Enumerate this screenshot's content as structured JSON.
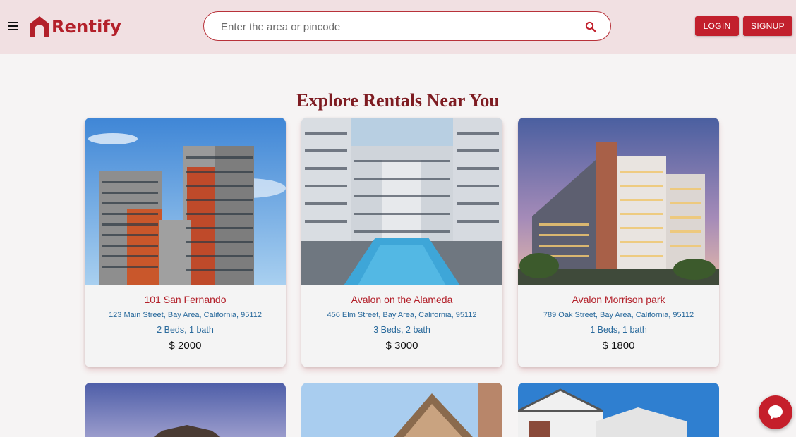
{
  "header": {
    "brand": "Rentify",
    "search_placeholder": "Enter the area or pincode",
    "login_label": "LOGIN",
    "signup_label": "SIGNUP",
    "icons": {
      "menu": "menu-icon",
      "search": "search-icon",
      "logo": "house-logo-icon"
    }
  },
  "main": {
    "heading": "Explore Rentals Near You",
    "listings": [
      {
        "name": "101 San Fernando",
        "address": "123 Main Street, Bay Area, California, 95112",
        "rooms": "2 Beds, 1 bath",
        "price": "$ 2000"
      },
      {
        "name": "Avalon on the Alameda",
        "address": "456 Elm Street, Bay Area, California, 95112",
        "rooms": "3 Beds, 2 bath",
        "price": "$ 3000"
      },
      {
        "name": "Avalon Morrison park",
        "address": "789 Oak Street, Bay Area, California, 95112",
        "rooms": "1 Beds, 1 bath",
        "price": "$ 1800"
      }
    ]
  },
  "chat": {
    "icon": "chat-bubble-icon"
  },
  "colors": {
    "brand": "#b3202a",
    "heading": "#7e1c22",
    "header_bg": "#f1e0e2",
    "link": "#2a6a9c"
  }
}
